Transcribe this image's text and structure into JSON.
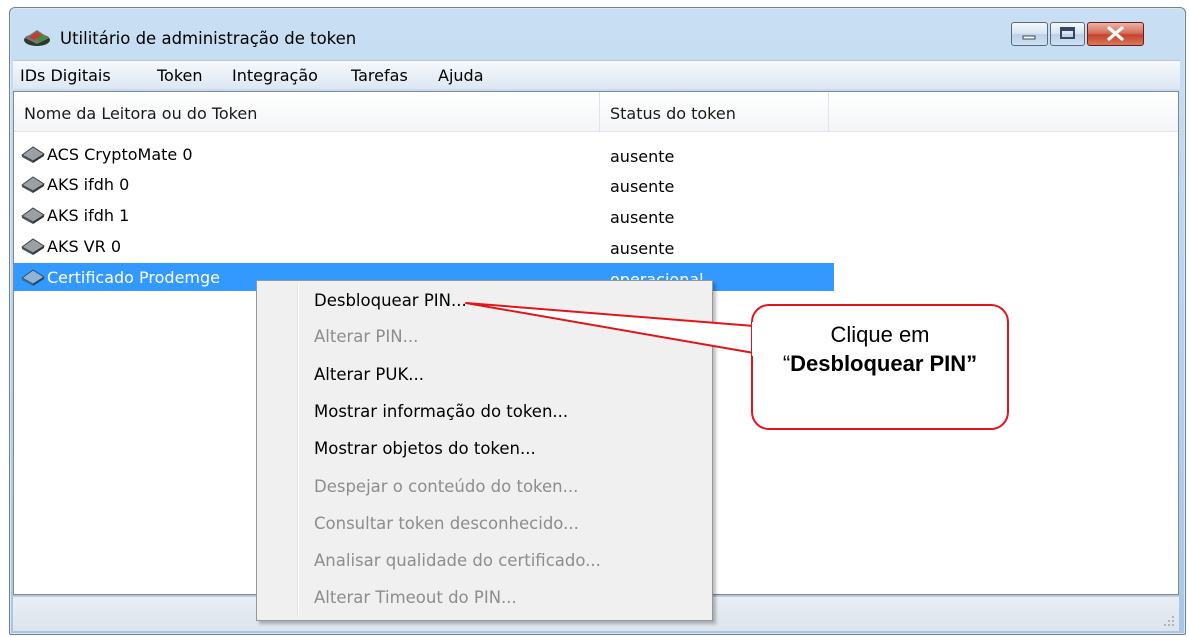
{
  "window": {
    "title": "Utilitário de administração de token",
    "controls": [
      "minimize",
      "maximize",
      "close"
    ]
  },
  "menubar": {
    "items": [
      "IDs Digitais",
      "Token",
      "Integração",
      "Tarefas",
      "Ajuda"
    ]
  },
  "list": {
    "columns": [
      "Nome da Leitora ou do Token",
      "Status do token"
    ],
    "rows": [
      {
        "name": "ACS CryptoMate 0",
        "status": "ausente",
        "icon": "card-reader-icon"
      },
      {
        "name": "AKS ifdh 0",
        "status": "ausente",
        "icon": "card-reader-icon"
      },
      {
        "name": "AKS ifdh 1",
        "status": "ausente",
        "icon": "card-reader-icon"
      },
      {
        "name": "AKS VR 0",
        "status": "ausente",
        "icon": "card-reader-icon"
      },
      {
        "name": "Certificado Prodemge",
        "status": "operacional",
        "icon": "token-icon",
        "selected": true
      }
    ]
  },
  "context_menu": {
    "items": [
      {
        "label": "Desbloquear PIN...",
        "enabled": true
      },
      {
        "label": "Alterar PIN...",
        "enabled": false
      },
      {
        "label": "Alterar PUK...",
        "enabled": true
      },
      {
        "label": "Mostrar informação do token...",
        "enabled": true
      },
      {
        "label": "Mostrar objetos do token...",
        "enabled": true
      },
      {
        "label": "Despejar o conteúdo do token...",
        "enabled": false
      },
      {
        "label": "Consultar token desconhecido...",
        "enabled": false
      },
      {
        "label": "Analisar qualidade do certificado...",
        "enabled": false
      },
      {
        "label": "Alterar Timeout do PIN...",
        "enabled": false
      }
    ]
  },
  "callout": {
    "line1": "Clique em",
    "open_quote": "“",
    "bold": "Desbloquear PIN”",
    "border_color": "#e0151a"
  },
  "colors": {
    "selection": "#3399ff",
    "disabled_text": "#8d8d8d",
    "callout_border": "#e0151a"
  }
}
